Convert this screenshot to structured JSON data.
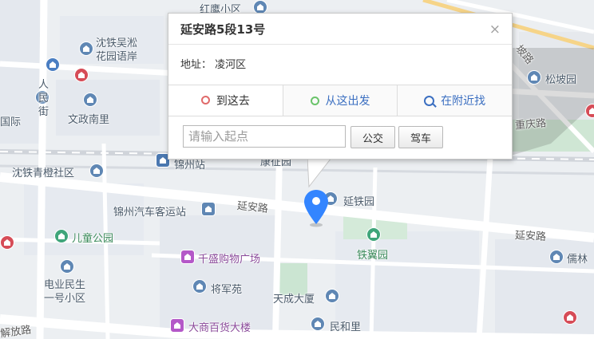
{
  "map": {
    "labels": {
      "hongying": "红鹰小区",
      "shentie_wusong": "沈铁吴淞\n花园语岸",
      "renmin": "人\n民\n街",
      "wenzheng": "文政南里",
      "jinzhou_zhan": "锦州站",
      "kangzheng": "康征园",
      "shentie_qingcheng": "沈铁青橙社区",
      "bus_station": "锦州汽车客运站",
      "yanan_road_1": "延安路",
      "yantie": "延铁园",
      "yanan_road_2": "延安路",
      "ertong": "儿童公园",
      "tiepu": "铁翼园",
      "qiansheng": "千盛购物广场",
      "dianye": "电业民生\n一号小区",
      "jiangjun": "将军苑",
      "tiancheng": "天成大厦",
      "dashang": "大商百货大楼",
      "minhe": "民和里",
      "jiefang": "解放路",
      "songpo": "松坡园",
      "songpo_road": "坡路",
      "chongqing_road": "重庆路",
      "rulin": "儒林",
      "guoji": "国际"
    }
  },
  "info_window": {
    "title": "延安路5段13号",
    "close": "×",
    "address_label": "地址：",
    "address_value": "凌河区",
    "tabs": [
      "到这去",
      "从这出发",
      "在附近找"
    ],
    "start_placeholder": "请输入起点",
    "btn_bus": "公交",
    "btn_car": "驾车"
  },
  "colors": {
    "marker": "#3385ff",
    "road": "#ffffff",
    "green_area": "#c8e4cf"
  }
}
